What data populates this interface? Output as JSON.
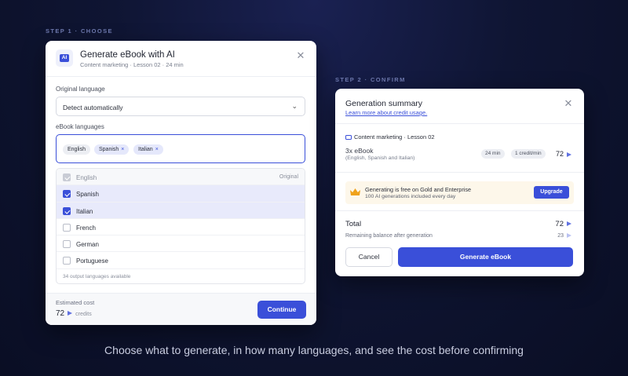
{
  "step1": {
    "label": "STEP 1 · CHOOSE"
  },
  "step2": {
    "label": "STEP 2 · CONFIRM"
  },
  "modal1": {
    "badge": "AI",
    "title": "Generate eBook with AI",
    "subtitle": "Content marketing · Lesson 02 · 24 min",
    "close_icon": "close-icon",
    "original_language_label": "Original language",
    "original_language_value": "Detect automatically",
    "ebook_languages_label": "eBook languages",
    "tags": [
      {
        "label": "English"
      },
      {
        "label": "Spanish",
        "remove": "×"
      },
      {
        "label": "Italian",
        "remove": "×"
      }
    ],
    "options": [
      {
        "label": "English",
        "state": "disabled",
        "note": "Original"
      },
      {
        "label": "Spanish",
        "state": "checked"
      },
      {
        "label": "Italian",
        "state": "checked"
      },
      {
        "label": "French",
        "state": "unchecked"
      },
      {
        "label": "German",
        "state": "unchecked"
      },
      {
        "label": "Portuguese",
        "state": "unchecked"
      }
    ],
    "dropdown_footer": "34 output languages available",
    "estimated_cost_label": "Estimated cost",
    "estimated_cost_value": "72",
    "credits_label": "credits",
    "continue_label": "Continue"
  },
  "modal2": {
    "title": "Generation summary",
    "link": "Learn more about credit usage.",
    "lesson": "Content marketing · Lesson 02",
    "ebook_title": "3x eBook",
    "ebook_sub": "(English, Spanish and Italian)",
    "pill_duration": "24 min",
    "pill_rate": "1 credit/min",
    "ebook_cost": "72",
    "promo_title": "Generating is free on Gold and Enterprise",
    "promo_sub": "100 AI generations included every day",
    "upgrade_label": "Upgrade",
    "total_label": "Total",
    "total_value": "72",
    "remaining_label": "Remaining balance after generation",
    "remaining_value": "23",
    "cancel_label": "Cancel",
    "generate_label": "Generate eBook"
  },
  "caption": "Choose what to generate, in how many languages, and see the cost before confirming",
  "colors": {
    "accent": "#3a4fd9",
    "background": "#0f1533",
    "promo": "#fdf7ea",
    "crown": "#f0a21b"
  }
}
